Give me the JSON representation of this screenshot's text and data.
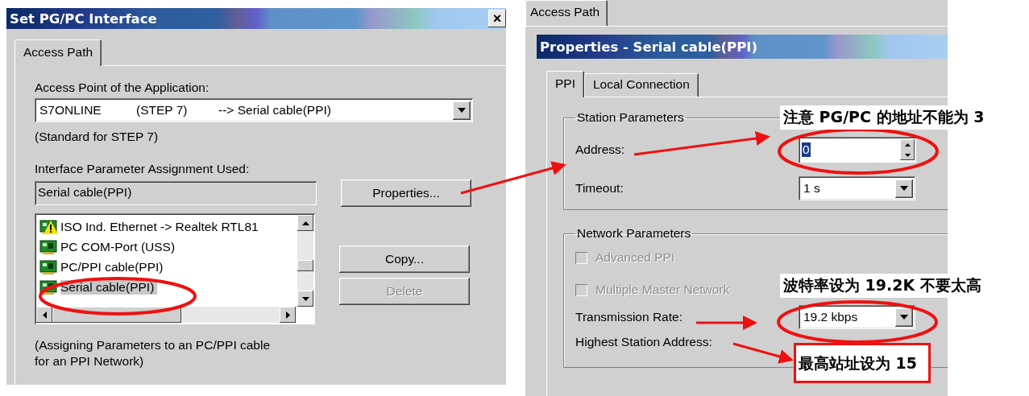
{
  "set_pg_pc_dialog": {
    "title": "Set PG/PC Interface",
    "close": "×",
    "tabs": [
      {
        "label": "Access Path",
        "selected": true
      }
    ],
    "access_point": {
      "label": "Access Point of the Application:",
      "value_columns": [
        "S7ONLINE",
        "(STEP 7)",
        "--> Serial cable(PPI)"
      ]
    },
    "access_point_note": "(Standard for STEP 7)",
    "assignment": {
      "label": "Interface Parameter Assignment Used:",
      "value": "Serial cable(PPI)"
    },
    "properties_button": {
      "label": "Properties...",
      "disabled": false
    },
    "interface_list": [
      {
        "label": "ISO Ind. Ethernet -> Realtek RTL81",
        "warning": true,
        "selected": false
      },
      {
        "label": "PC COM-Port (USS)",
        "warning": false,
        "selected": false
      },
      {
        "label": "PC/PPI cable(PPI)",
        "warning": false,
        "selected": false
      },
      {
        "label": "Serial cable(PPI)",
        "warning": false,
        "selected": true
      }
    ],
    "side_buttons": [
      {
        "label": "Copy...",
        "disabled": false
      },
      {
        "label": "Delete",
        "disabled": true
      }
    ],
    "footnote": "(Assigning Parameters to an PC/PPI cable\nfor an PPI Network)"
  },
  "properties_dialog": {
    "background_tab": {
      "label": "Access Path",
      "selected": true
    },
    "title": "Properties - Serial cable(PPI)",
    "tabs": [
      {
        "label": "PPI",
        "selected": true
      },
      {
        "label": "Local Connection",
        "selected": false
      }
    ],
    "station_parameters": {
      "title": "Station Parameters",
      "address": {
        "label": "Address:",
        "value": "0"
      },
      "timeout": {
        "label": "Timeout:",
        "value": "1 s"
      }
    },
    "network_parameters": {
      "title": "Network Parameters",
      "options": [
        {
          "label": "Advanced PPI",
          "checked": false,
          "disabled": true
        },
        {
          "label": "Multiple Master Network",
          "checked": false,
          "disabled": true
        }
      ],
      "transmission_rate": {
        "label": "Transmission Rate:",
        "value": "19.2 kbps"
      },
      "highest_station_address": {
        "label": "Highest Station Address:"
      }
    }
  },
  "annotations": [
    {
      "kind": "note",
      "text": "注意 PG/PC 的地址不能为 3"
    },
    {
      "kind": "note",
      "text": "波特率设为 19.2K 不要太高"
    },
    {
      "kind": "boxed",
      "text": "最高站址设为 15"
    }
  ]
}
